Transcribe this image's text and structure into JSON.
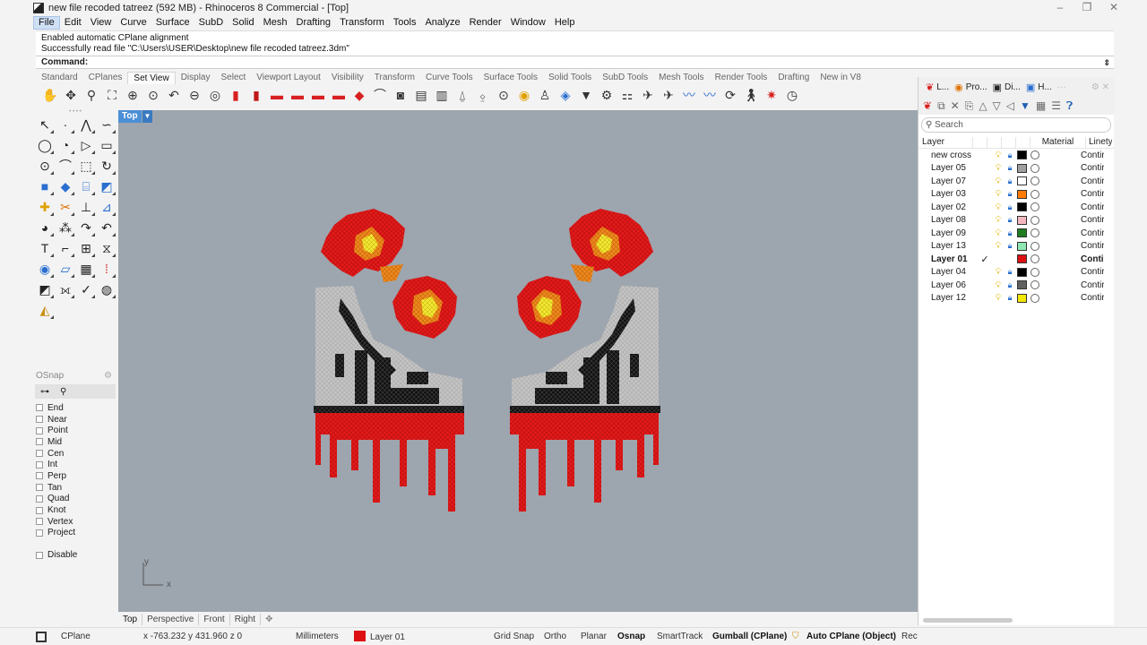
{
  "window": {
    "title": "new file recoded tatreez (592 MB) - Rhinoceros 8 Commercial - [Top]",
    "minimize": "–",
    "maximize": "❐",
    "close": "✕"
  },
  "menu": [
    "File",
    "Edit",
    "View",
    "Curve",
    "Surface",
    "SubD",
    "Solid",
    "Mesh",
    "Drafting",
    "Transform",
    "Tools",
    "Analyze",
    "Render",
    "Window",
    "Help"
  ],
  "command_history": [
    "Enabled automatic CPlane alignment",
    "Successfully read file \"C:\\Users\\USER\\Desktop\\new file recoded tatreez.3dm\""
  ],
  "command_prompt": "Command:",
  "toolbar_tabs": [
    "Standard",
    "CPlanes",
    "Set View",
    "Display",
    "Select",
    "Viewport Layout",
    "Visibility",
    "Transform",
    "Curve Tools",
    "Surface Tools",
    "Solid Tools",
    "SubD Tools",
    "Mesh Tools",
    "Render Tools",
    "Drafting",
    "New in V8"
  ],
  "active_toolbar_tab": "Set View",
  "osnap": {
    "title": "OSnap",
    "items": [
      "End",
      "Near",
      "Point",
      "Mid",
      "Cen",
      "Int",
      "Perp",
      "Tan",
      "Quad",
      "Knot",
      "Vertex",
      "Project"
    ],
    "disable": "Disable"
  },
  "viewport": {
    "title": "Top",
    "axis_y": "y",
    "axis_x": "x",
    "background": "#9da5ae"
  },
  "viewport_tabs": [
    "Top",
    "Perspective",
    "Front",
    "Right"
  ],
  "status": {
    "cplane": "CPlane",
    "coords": "x -763.232  y 431.960  z 0",
    "units": "Millimeters",
    "layer": "Layer 01",
    "grid_snap": "Grid Snap",
    "ortho": "Ortho",
    "planar": "Planar",
    "osnap": "Osnap",
    "smarttrack": "SmartTrack",
    "gumball": "Gumball (CPlane)",
    "auto_cplane": "Auto CPlane (Object)",
    "record": "Rec"
  },
  "panel": {
    "tabs": [
      {
        "label": "L...",
        "icon": "layers-icon"
      },
      {
        "label": "Pro...",
        "icon": "properties-icon"
      },
      {
        "label": "Di...",
        "icon": "display-icon"
      },
      {
        "label": "H...",
        "icon": "help-icon"
      }
    ],
    "more": "···",
    "search_placeholder": "Search",
    "columns": {
      "layer": "Layer",
      "material": "Material",
      "linetype": "Linety"
    },
    "layers": [
      {
        "name": "new cross",
        "color": "#000000",
        "current": false,
        "linetype": "Contir"
      },
      {
        "name": "Layer 05",
        "color": "#a0a0a0",
        "current": false,
        "linetype": "Contir"
      },
      {
        "name": "Layer 07",
        "color": "#ffffff",
        "current": false,
        "linetype": "Contir"
      },
      {
        "name": "Layer 03",
        "color": "#ff7b00",
        "current": false,
        "linetype": "Contir"
      },
      {
        "name": "Layer 02",
        "color": "#000000",
        "current": false,
        "linetype": "Contir"
      },
      {
        "name": "Layer 08",
        "color": "#f5b8c0",
        "current": false,
        "linetype": "Contir"
      },
      {
        "name": "Layer 09",
        "color": "#1e7d1e",
        "current": false,
        "linetype": "Contir"
      },
      {
        "name": "Layer 13",
        "color": "#8fe8b0",
        "current": false,
        "linetype": "Contir"
      },
      {
        "name": "Layer 01",
        "color": "#dd1111",
        "current": true,
        "linetype": "Contir"
      },
      {
        "name": "Layer 04",
        "color": "#000000",
        "current": false,
        "linetype": "Contir"
      },
      {
        "name": "Layer 06",
        "color": "#606060",
        "current": false,
        "linetype": "Contir"
      },
      {
        "name": "Layer 12",
        "color": "#f5e800",
        "current": false,
        "linetype": "Contir"
      }
    ]
  },
  "colors": {
    "active_tab": "#4b8fd6",
    "stitch_red": "#e41b1b",
    "stitch_orange": "#f08a1e",
    "stitch_yellow": "#f3e83a",
    "stitch_black": "#111111",
    "stitch_grey": "#c2c2c2"
  }
}
